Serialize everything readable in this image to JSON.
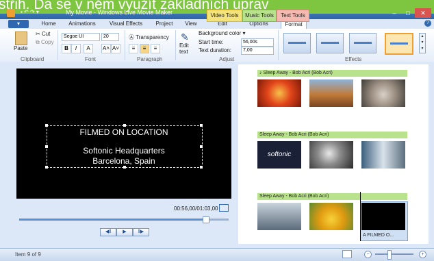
{
  "overlay_caption": "střih. Da se v něm využít základních úprav",
  "window": {
    "title": "My Movie - Windows Live Movie Maker",
    "qat": "▪ ↶ ↷ ▾",
    "min": "–",
    "max": "□",
    "close": "✕"
  },
  "contextual_tabs": {
    "video": "Video Tools",
    "music": "Music Tools",
    "text": "Text Tools"
  },
  "ribbon_tabs": [
    "Home",
    "Animations",
    "Visual Effects",
    "Project",
    "View",
    "Edit",
    "Options",
    "Format"
  ],
  "file_menu": "▾",
  "help": "?",
  "clipboard": {
    "paste": "Paste",
    "cut": "Cut",
    "copy": "Copy",
    "label": "Clipboard"
  },
  "font": {
    "family": "Segoe UI",
    "size": "20",
    "bold": "B",
    "italic": "I",
    "color": "A",
    "grow": "A˄",
    "shrink": "A˅",
    "label": "Font"
  },
  "paragraph": {
    "transparency": "Transparency",
    "label": "Paragraph"
  },
  "adjust": {
    "edit_text": "Edit\ntext",
    "background_color": "Background color ▾",
    "start_time_label": "Start time:",
    "start_time_value": "56,00s",
    "duration_label": "Text duration:",
    "duration_value": "7,00",
    "label": "Adjust"
  },
  "effects": {
    "label": "Effects"
  },
  "preview": {
    "line1": "FILMED ON LOCATION",
    "line2": "Softonic Headquarters",
    "line3": "Barcelona, Spain",
    "timecode": "00:56,00/01:03,00",
    "prev_frame": "◀‖",
    "play": "▶",
    "next_frame": "‖▶",
    "progress": 0.889
  },
  "storyboard": {
    "rows": [
      {
        "label": "♪ Sleep Away - Bob Acri (Bob Acri)"
      },
      {
        "label": "Sleep Away - Bob Acri (Bob Acri)"
      },
      {
        "label": "Sleep Away - Bob Acri (Bob Acri)"
      }
    ],
    "softonic_logo": "softonic",
    "selected_clip_label": "A FILMED O..."
  },
  "status": {
    "text": "Item 9 of 9",
    "zoom_out": "−",
    "zoom_in": "+",
    "zoom_level": 0.35
  },
  "colors": {
    "accent": "#2f67b0",
    "music_row": "#b9e28c",
    "text_tab": "#f4b9b0",
    "video_tab": "#f4e27a"
  }
}
